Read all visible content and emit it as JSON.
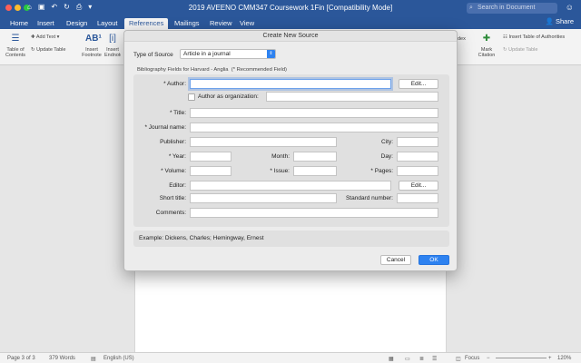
{
  "window": {
    "title": "2019 AVEENO CMM347 Coursework 1Fin [Compatibility Mode]",
    "search_placeholder": "Search in Document"
  },
  "ribbon_tabs": [
    "Home",
    "Insert",
    "Design",
    "Layout",
    "References",
    "Mailings",
    "Review",
    "View"
  ],
  "share_label": "Share",
  "ribbon": {
    "toc": "Table of Contents",
    "add_text": "Add Text",
    "update_table": "Update Table",
    "insert_footnote": "Insert Footnote",
    "insert_endnote": "Insert Endnote",
    "mark_citation": "Mark Citation",
    "insert_toa": "Insert Table of Authorities",
    "update_table_right": "Update Table",
    "index_partial": "dex"
  },
  "dialog": {
    "title": "Create New Source",
    "type_label": "Type of Source",
    "type_value": "Article in a journal",
    "fields_caption": "Bibliography Fields for Harvard - Anglia",
    "recommended_caption": "(* Recommended Field)",
    "author_label": "* Author:",
    "edit_label": "Edit...",
    "org_label": "Author as organization:",
    "title_label": "* Title:",
    "journal_label": "* Journal name:",
    "publisher_label": "Publisher:",
    "city_label": "City:",
    "year_label": "* Year:",
    "month_label": "Month:",
    "day_label": "Day:",
    "volume_label": "* Volume:",
    "issue_label": "* Issue:",
    "pages_label": "* Pages:",
    "editor_label": "Editor:",
    "short_title_label": "Short title:",
    "standard_number_label": "Standard number:",
    "comments_label": "Comments:",
    "example": "Example: Dickens, Charles; Hemingway, Ernest",
    "cancel": "Cancel",
    "ok": "OK"
  },
  "status": {
    "page": "Page 3 of 3",
    "words": "379 Words",
    "language": "English (US)",
    "focus": "Focus",
    "zoom": "120%"
  }
}
